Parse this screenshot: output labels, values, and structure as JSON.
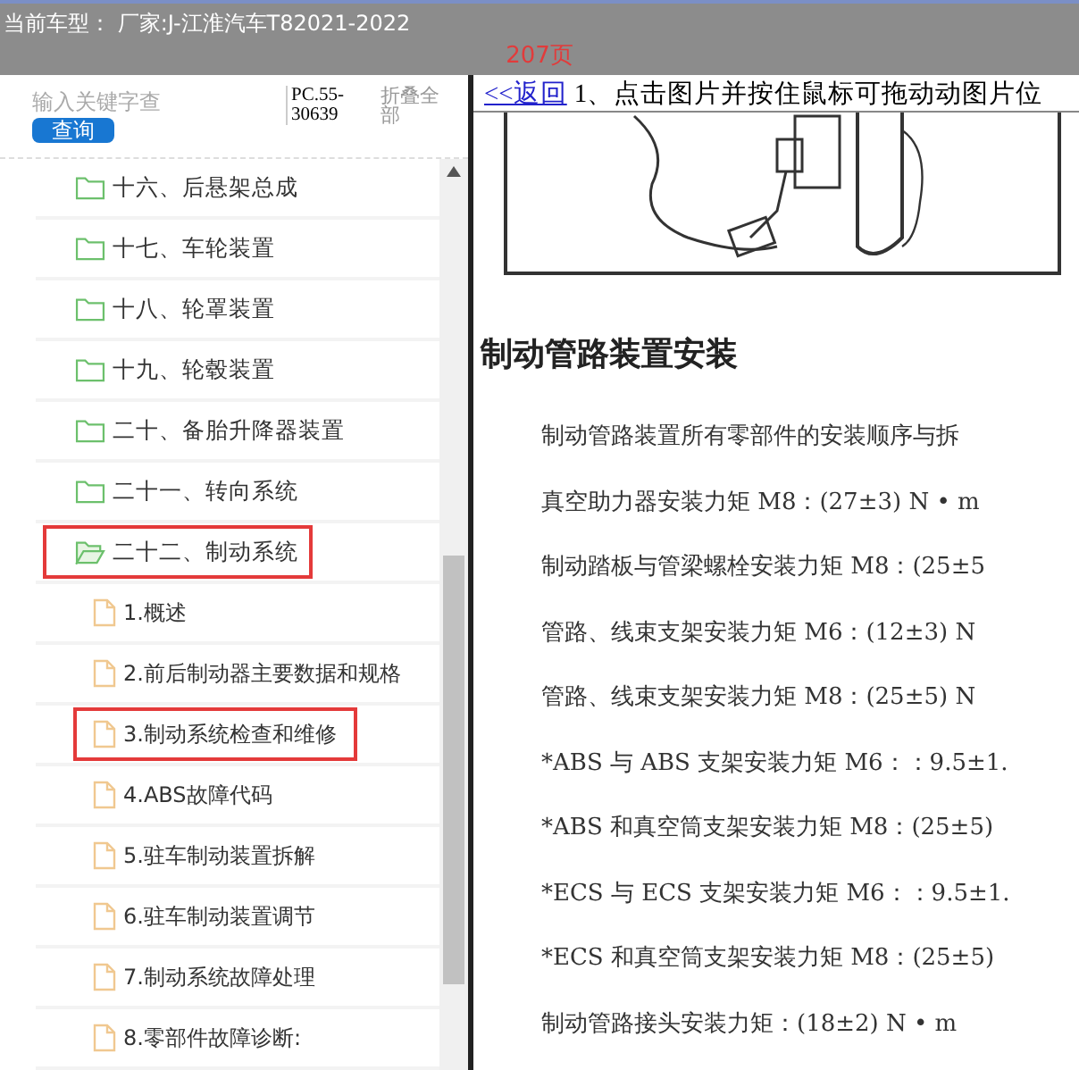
{
  "header": {
    "vehicle": "当前车型： 厂家:J-江淮汽车T82021-2022",
    "page_count": "207页"
  },
  "search": {
    "placeholder": "输入关键字查",
    "button": "查询",
    "code": "PC.55-30639",
    "collapse_all": "折叠全部"
  },
  "tree": [
    {
      "label": "十六、后悬架总成",
      "expanded": false,
      "marked": false
    },
    {
      "label": "十七、车轮装置",
      "expanded": false,
      "marked": false
    },
    {
      "label": "十八、轮罩装置",
      "expanded": false,
      "marked": false
    },
    {
      "label": "十九、轮毂装置",
      "expanded": false,
      "marked": false
    },
    {
      "label": "二十、备胎升降器装置",
      "expanded": false,
      "marked": false
    },
    {
      "label": "二十一、转向系统",
      "expanded": false,
      "marked": false
    },
    {
      "label": "二十二、制动系统",
      "expanded": true,
      "marked": true,
      "children": [
        {
          "label": "1.概述",
          "marked": false
        },
        {
          "label": "2.前后制动器主要数据和规格",
          "marked": false
        },
        {
          "label": "3.制动系统检查和维修",
          "marked": true
        },
        {
          "label": "4.ABS故障代码",
          "marked": false
        },
        {
          "label": "5.驻车制动装置拆解",
          "marked": false
        },
        {
          "label": "6.驻车制动装置调节",
          "marked": false
        },
        {
          "label": "7.制动系统故障处理",
          "marked": false
        },
        {
          "label": "8.零部件故障诊断:",
          "marked": false
        }
      ]
    }
  ],
  "content": {
    "back_link": "<<返回",
    "hint": "1、点击图片并按住鼠标可拖动动图片位",
    "heading": "制动管路装置安装",
    "lines": [
      "制动管路装置所有零部件的安装顺序与拆",
      "真空助力器安装力矩 M8：(27±3) N • m",
      "制动踏板与管梁螺栓安装力矩 M8：(25±5",
      "管路、线束支架安装力矩 M6：(12±3) N",
      "管路、线束支架安装力矩 M8：(25±5) N",
      "*ABS 与 ABS 支架安装力矩 M6：：9.5±1.",
      "*ABS 和真空筒支架安装力矩 M8：(25±5)",
      "*ECS 与 ECS 支架安装力矩 M6：：9.5±1.",
      "*ECS 和真空筒支架安装力矩 M8：(25±5)",
      "制动管路接头安装力矩：(18±2) N • m"
    ]
  }
}
